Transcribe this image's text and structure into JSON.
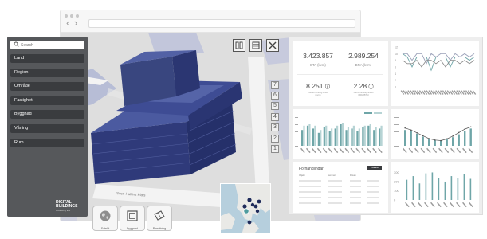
{
  "search": {
    "placeholder": "Search"
  },
  "sidebar": {
    "items": [
      {
        "label": "Land"
      },
      {
        "label": "Region"
      },
      {
        "label": "Område"
      },
      {
        "label": "Fastighet"
      },
      {
        "label": "Byggnad"
      },
      {
        "label": "Våning"
      },
      {
        "label": "Rum"
      }
    ]
  },
  "logo": {
    "line1": "DIGITAL",
    "line2": "BUILDINGS",
    "tagline": "Powered by Esri"
  },
  "map": {
    "street_label": "Sven Hultins Plats"
  },
  "floors": [
    "7",
    "6",
    "5",
    "4",
    "3",
    "2",
    "1"
  ],
  "view_buttons": [
    {
      "label": "Satellit",
      "icon": "globe-icon"
    },
    {
      "label": "Byggnad",
      "icon": "building-icon"
    },
    {
      "label": "Planritning",
      "icon": "floorplan-icon"
    }
  ],
  "tools": [
    {
      "icon": "split-view-icon"
    },
    {
      "icon": "layers-icon"
    },
    {
      "icon": "close-icon"
    }
  ],
  "kpis": {
    "bta": {
      "value": "3.423.857",
      "label": "BTA (kvm)"
    },
    "bra": {
      "value": "2.989.254",
      "label": "BRA (kvm)"
    },
    "area_avg": {
      "value": "8.251",
      "label": "Genomsnittlig area",
      "unit": "(kvm)"
    },
    "ratio": {
      "value": "2.28",
      "label": "Genomsnittlig andel",
      "unit": "(BRA/BTA)"
    }
  },
  "table": {
    "title": "Förhandlingar",
    "button": "Visa alla",
    "headers": [
      "Objekt",
      "Nummer",
      "Datum"
    ]
  },
  "chart_data": [
    {
      "type": "line",
      "ylim": [
        0,
        12
      ],
      "yticks": [
        0,
        2,
        4,
        6,
        8,
        10,
        12
      ],
      "series": [
        {
          "values": [
            10,
            9,
            6,
            9,
            9,
            9,
            5,
            9,
            9,
            9,
            6,
            9,
            9,
            9,
            8,
            9
          ]
        },
        {
          "values": [
            10,
            10,
            8,
            10,
            10,
            7,
            10,
            9,
            10,
            10,
            8,
            10,
            9,
            10,
            9,
            10
          ]
        },
        {
          "values": [
            8,
            7,
            7,
            8,
            6,
            8,
            8,
            7,
            8,
            6,
            8,
            8,
            7,
            8,
            7,
            8
          ]
        }
      ],
      "colors": [
        "#6fa6a8",
        "#9aa0b8",
        "#8c8c8c"
      ]
    },
    {
      "type": "bar",
      "legend": [
        "",
        ""
      ],
      "legend_position": "top-right",
      "categories": [
        "",
        "",
        "",
        "",
        "",
        "",
        "",
        "",
        "",
        "",
        "",
        "",
        "",
        "",
        ""
      ],
      "series": [
        {
          "values": [
            0.55,
            0.7,
            0.6,
            0.45,
            0.65,
            0.5,
            0.6,
            0.75,
            0.55,
            0.6,
            0.5,
            0.65,
            0.7,
            0.55,
            0.6
          ]
        },
        {
          "values": [
            0.7,
            0.75,
            0.7,
            0.55,
            0.7,
            0.6,
            0.7,
            0.8,
            0.65,
            0.7,
            0.6,
            0.7,
            0.75,
            0.65,
            0.7
          ]
        }
      ],
      "colors": [
        "#6fa6a8",
        "#b7d4d5"
      ],
      "ylim": [
        0,
        1
      ]
    },
    {
      "type": "bar",
      "categories": [
        "",
        "",
        "",
        "",
        "",
        "",
        "",
        "",
        "",
        "",
        "",
        ""
      ],
      "values": [
        0.55,
        0.5,
        0.42,
        0.32,
        0.25,
        0.2,
        0.18,
        0.22,
        0.3,
        0.4,
        0.52,
        0.6
      ],
      "line": [
        0.62,
        0.55,
        0.45,
        0.35,
        0.25,
        0.2,
        0.18,
        0.24,
        0.34,
        0.46,
        0.58,
        0.66
      ],
      "colors": [
        "#6fa6a8",
        "#555555"
      ],
      "ylim": [
        0,
        1
      ]
    },
    {
      "type": "bar",
      "categories": [
        "",
        "",
        "",
        "",
        "",
        "",
        "",
        "",
        "",
        "",
        ""
      ],
      "values": [
        220,
        260,
        180,
        290,
        300,
        240,
        200,
        260,
        240,
        280,
        230
      ],
      "yticks": [
        0,
        100,
        200,
        300
      ],
      "ylim": [
        0,
        330
      ],
      "colors": [
        "#6fa6a8"
      ]
    }
  ]
}
